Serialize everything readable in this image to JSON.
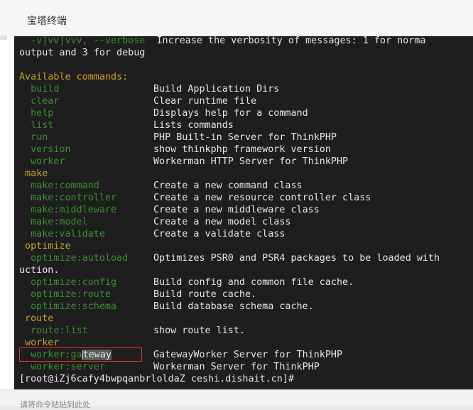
{
  "window": {
    "title": "宝塔终端"
  },
  "terminal": {
    "verbose_line": {
      "option": "  -v|vv|vvv, --verbose",
      "description": "  Increase the verbosity of messages: 1 for norma"
    },
    "verbose_wrap": "output and 3 for debug",
    "available_header": "Available commands:",
    "commands_top": [
      {
        "cmd": "  build",
        "desc": "Build Application Dirs"
      },
      {
        "cmd": "  clear",
        "desc": "Clear runtime file"
      },
      {
        "cmd": "  help",
        "desc": "Displays help for a command"
      },
      {
        "cmd": "  list",
        "desc": "Lists commands"
      },
      {
        "cmd": "  run",
        "desc": "PHP Built-in Server for ThinkPHP"
      },
      {
        "cmd": "  version",
        "desc": "show thinkphp framework version"
      },
      {
        "cmd": "  worker",
        "desc": "Workerman HTTP Server for ThinkPHP"
      }
    ],
    "group_make": " make",
    "commands_make": [
      {
        "cmd": "  make:command",
        "desc": "Create a new command class"
      },
      {
        "cmd": "  make:controller",
        "desc": "Create a new resource controller class"
      },
      {
        "cmd": "  make:middleware",
        "desc": "Create a new middleware class"
      },
      {
        "cmd": "  make:model",
        "desc": "Create a new model class"
      },
      {
        "cmd": "  make:validate",
        "desc": "Create a validate class"
      }
    ],
    "group_optimize": " optimize",
    "optimize_autoload": {
      "cmd": "  optimize:autoload",
      "desc": "Optimizes PSR0 and PSR4 packages to be loaded with"
    },
    "optimize_wrap": "uction.",
    "commands_optimize": [
      {
        "cmd": "  optimize:config",
        "desc": "Build config and common file cache."
      },
      {
        "cmd": "  optimize:route",
        "desc": "Build route cache."
      },
      {
        "cmd": "  optimize:schema",
        "desc": "Build database schema cache."
      }
    ],
    "group_route": " route",
    "commands_route": [
      {
        "cmd": "  route:list",
        "desc": "show route list."
      }
    ],
    "group_worker": " worker",
    "worker_gateway": {
      "cmd_before": "  worker:ga",
      "cmd_selected": "teway",
      "desc": "GatewayWorker Server for ThinkPHP"
    },
    "worker_server": {
      "cmd": "  worker:server",
      "desc": "Workerman Server for ThinkPHP"
    },
    "prompt": "[root@iZj6cafy4bwpqanbrloldaZ ceshi.dishait.cn]#"
  },
  "footer": {
    "text": "请将命令粘贴到此处"
  }
}
